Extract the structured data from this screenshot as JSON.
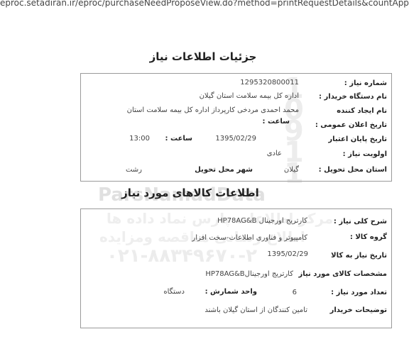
{
  "url": "eproc.setadiran.ir/eproc/purchaseNeedProposeView.do?method=printRequestDetails&countAppendix=",
  "section1": {
    "title": "جزئیات اطلاعات نیاز",
    "need_number_label": "شماره نیاز :",
    "need_number": "1295320800011",
    "buyer_label": "نام دستگاه خریدار :",
    "buyer": "اداره کل بیمه سلامت استان گیلان",
    "creator_label": "نام ایجاد کننده",
    "creator": "محمد احمدی مردخی کارپرداز اداره کل بیمه سلامت استان",
    "announce_date_label": "تاریخ اعلان عمومی :",
    "announce_time_label": "ساعت :",
    "validity_date_label": "تاریخ پایان اعتبار",
    "validity_date": "1395/02/29",
    "validity_time_label": "ساعت :",
    "validity_time": "13:00",
    "priority_label": "اولویت نیاز :",
    "priority": "عادی",
    "province_label": "استان محل تحویل :",
    "province": "گیلان",
    "city_label": "شهر محل تحویل",
    "city": "رشت"
  },
  "section2": {
    "title": "اطلاعات کالاهای مورد نیاز",
    "desc_label": "شرح کلی نیاز :",
    "desc": "کارتریج اورجینال HP78AG&B",
    "group_label": "گروه کالا :",
    "group": "کامپیوتر و فناوری اطلاعات-سخت افزار",
    "need_date_label": "تاریخ نیاز به کالا",
    "need_date": "1395/02/29",
    "spec_label": "مشخصات کالای مورد نیاز",
    "spec": "کارتریج اورجینالHP78AG&B",
    "qty_label": "تعداد مورد نیاز :",
    "qty": "6",
    "unit_label": "واحد شمارش :",
    "unit": "دستگاه",
    "buyer_notes_label": "توضیحات خریدار",
    "buyer_notes": "تامین کنندگان از استان گیلان باشند"
  },
  "watermark": {
    "brand": "ParsNamadData",
    "line1": "مرکز اطلاعات پارس نماد داده ها",
    "line2": "اطلاع رسانی مناقصه ومزایده",
    "phone": "۰۲۱-۸۸۳۴۹۶۷۰-۲",
    "digits": "1 0 9 1 1"
  }
}
